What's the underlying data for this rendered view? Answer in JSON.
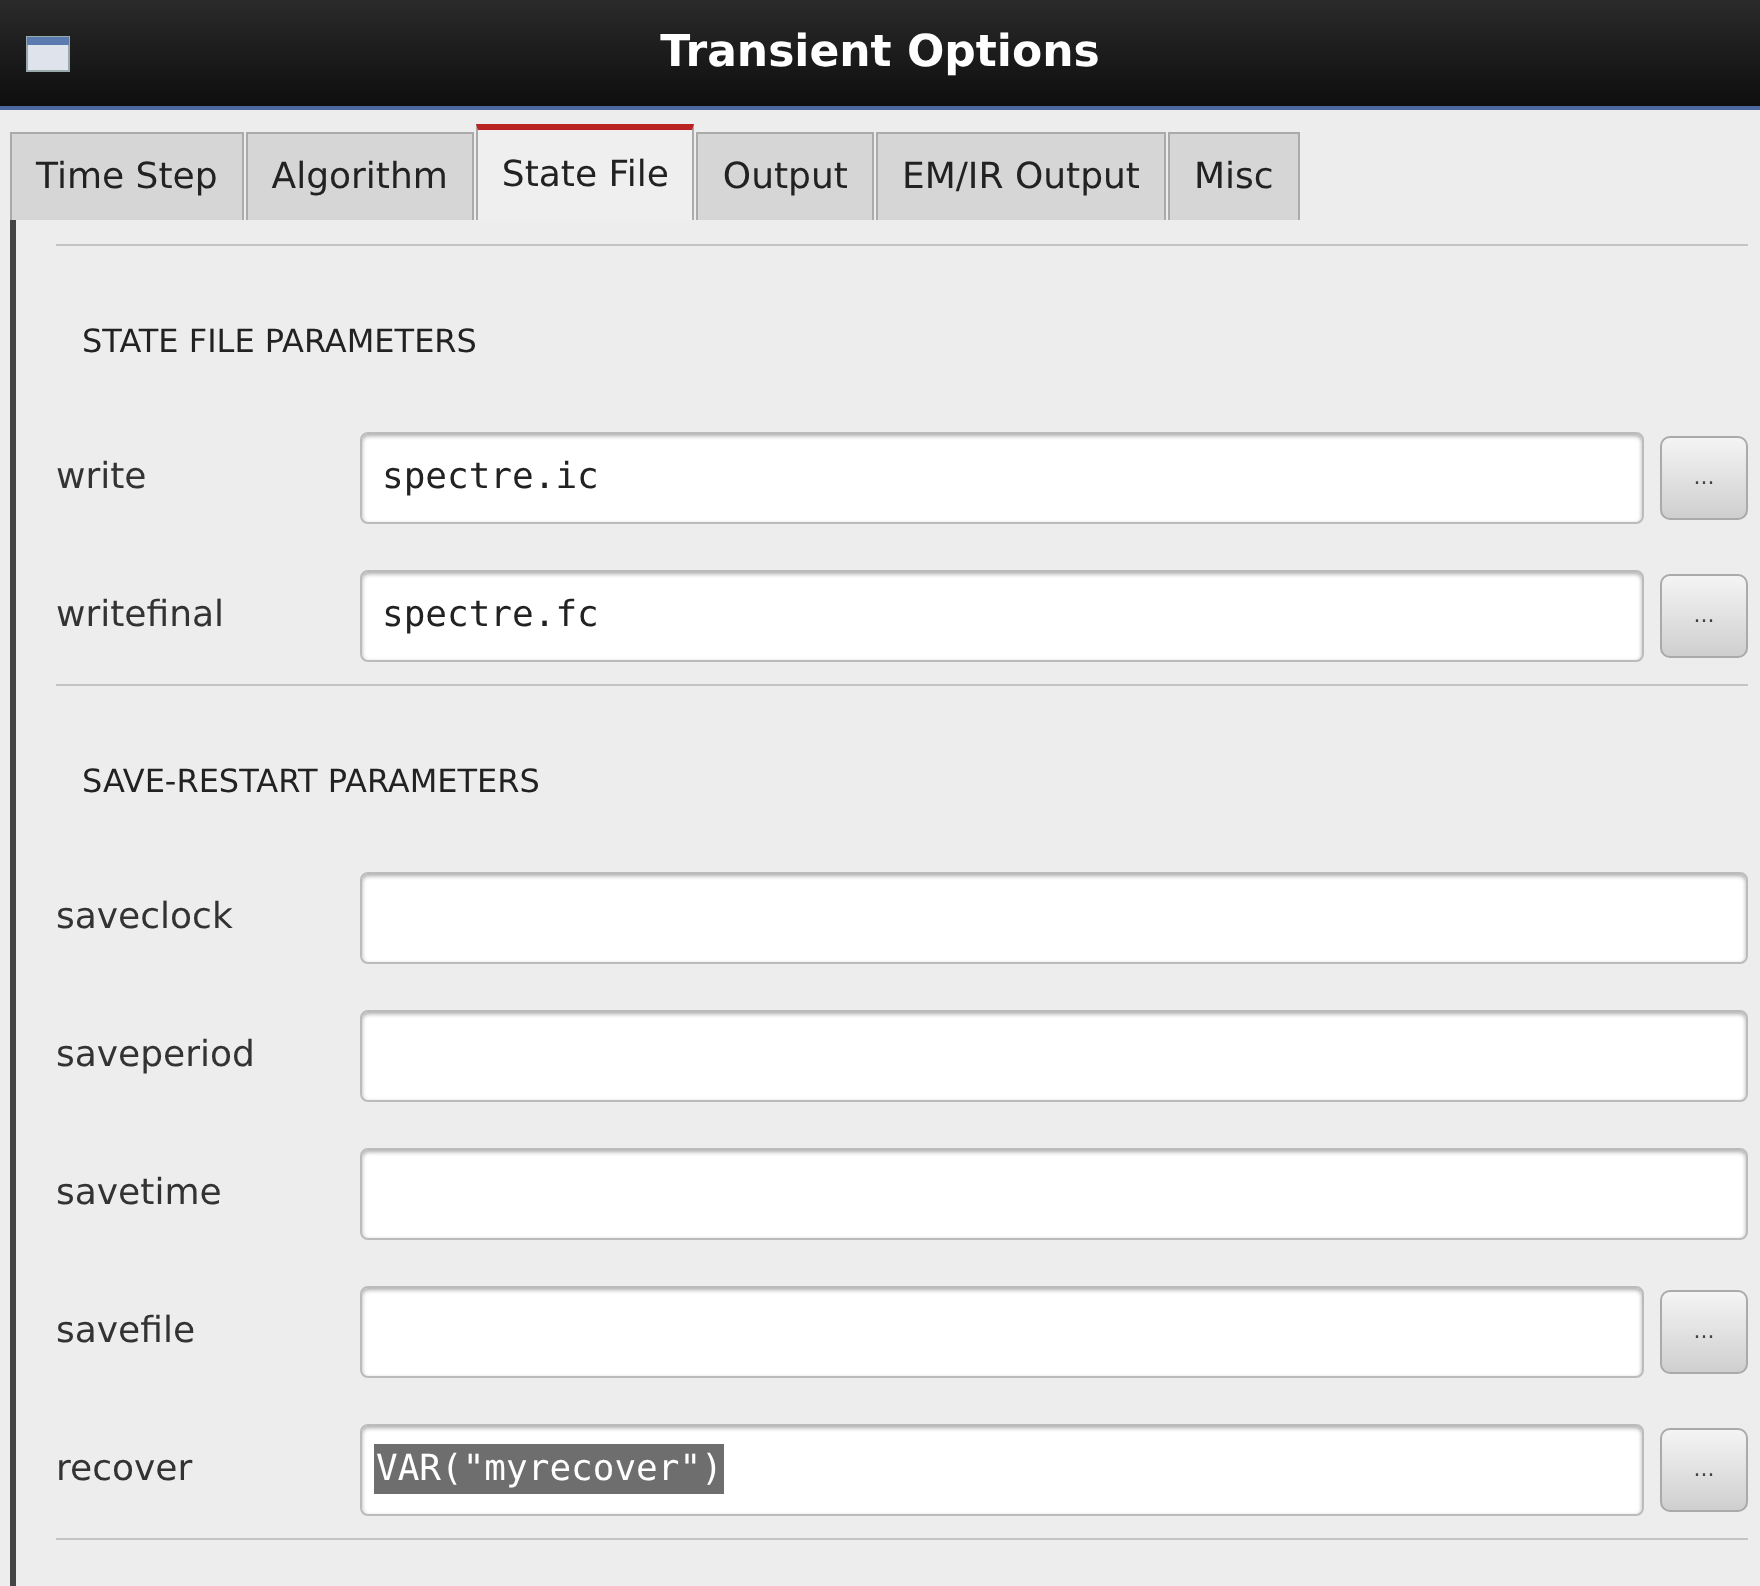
{
  "window": {
    "title": "Transient Options"
  },
  "tabs": [
    {
      "label": "Time Step",
      "selected": false
    },
    {
      "label": "Algorithm",
      "selected": false
    },
    {
      "label": "State File",
      "selected": true
    },
    {
      "label": "Output",
      "selected": false
    },
    {
      "label": "EM/IR Output",
      "selected": false
    },
    {
      "label": "Misc",
      "selected": false
    }
  ],
  "sections": [
    {
      "title": "STATE FILE PARAMETERS",
      "rows": [
        {
          "label": "write",
          "value": "spectre.ic",
          "browse": true,
          "selected": false
        },
        {
          "label": "writefinal",
          "value": "spectre.fc",
          "browse": true,
          "selected": false
        }
      ]
    },
    {
      "title": "SAVE-RESTART PARAMETERS",
      "rows": [
        {
          "label": "saveclock",
          "browse": false
        },
        {
          "label": "saveperiod",
          "browse": false
        },
        {
          "label": "savetime",
          "browse": false
        },
        {
          "label": "savefile",
          "browse": true
        },
        {
          "label": "recover",
          "value": "VAR(\"myrecover\")",
          "browse": true,
          "selected": true
        }
      ]
    }
  ],
  "browse_button": {
    "label": "..."
  }
}
